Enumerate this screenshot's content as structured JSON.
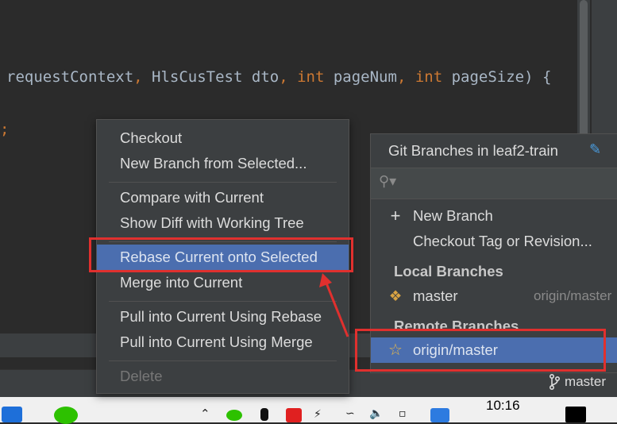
{
  "editor": {
    "code_parts": [
      "requestContext",
      ", ",
      "HlsCusTest",
      " dto",
      ", ",
      "int",
      " pageNum",
      ", ",
      "int",
      " pageSize",
      ") {"
    ],
    "semicolon": ";"
  },
  "context_menu": {
    "items": [
      {
        "label": "Checkout"
      },
      {
        "label": "New Branch from Selected..."
      },
      {
        "label": "Compare with Current"
      },
      {
        "label": "Show Diff with Working Tree"
      },
      {
        "label": "Rebase Current onto Selected"
      },
      {
        "label": "Merge into Current"
      },
      {
        "label": "Pull into Current Using Rebase"
      },
      {
        "label": "Pull into Current Using Merge"
      },
      {
        "label": "Delete"
      }
    ],
    "selected_index": 4
  },
  "branches_popup": {
    "title": "Git Branches in leaf2-train",
    "edit_icon": "edit-icon",
    "search_placeholder": "",
    "new_branch": "New Branch",
    "checkout_tag": "Checkout Tag or Revision...",
    "local_header": "Local Branches",
    "local_branch": {
      "name": "master",
      "tracking": "origin/master"
    },
    "remote_header": "Remote Branches",
    "remote_branch": {
      "name": "origin/master"
    }
  },
  "status_bar": {
    "branch": "master"
  },
  "taskbar": {
    "time": "10:16"
  },
  "colors": {
    "selection": "#4b6eaf",
    "annotation": "#e0302e",
    "keyword": "#cc7832"
  }
}
